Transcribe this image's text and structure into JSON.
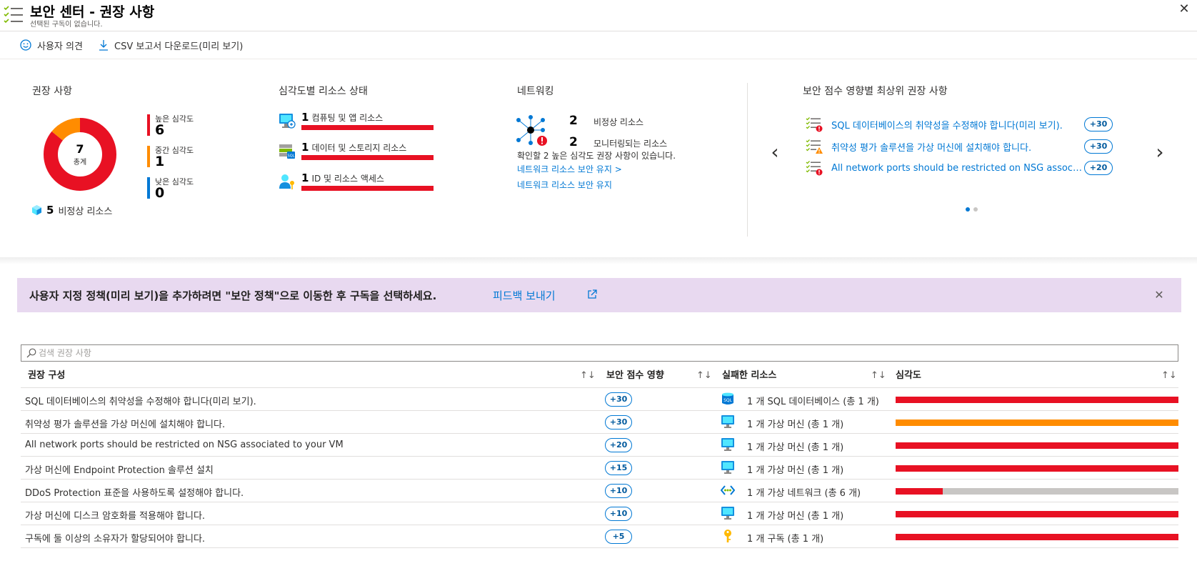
{
  "header": {
    "title": "보안 센터 - 권장 사항",
    "subtitle": "선택된 구독이 없습니다."
  },
  "toolbar": {
    "feedback_label": "사용자 의견",
    "download_label": "CSV 보고서 다운로드(미리 보기)"
  },
  "recommendations_summary": {
    "title": "권장 사항",
    "total": "7",
    "total_label": "총계",
    "high_label": "높은 심각도",
    "high_count": "6",
    "medium_label": "중간 심각도",
    "medium_count": "1",
    "low_label": "낮은 심각도",
    "low_count": "0",
    "unhealthy_count": "5",
    "unhealthy_label": "비정상 리소스",
    "colors": {
      "high": "#e81123",
      "medium": "#ff8c00",
      "low": "#0078d4"
    }
  },
  "resource_health": {
    "title": "심각도별 리소스 상태",
    "items": [
      {
        "count": "1",
        "label": "컴퓨팅 및 앱 리소스",
        "icon": "compute-icon"
      },
      {
        "count": "1",
        "label": "데이터 및 스토리지 리소스",
        "icon": "data-storage-icon"
      },
      {
        "count": "1",
        "label": "ID 및 리소스 액세스",
        "icon": "identity-icon"
      }
    ]
  },
  "networking": {
    "title": "네트워킹",
    "unhealthy_count": "2",
    "unhealthy_label": "비정상 리소스",
    "monitored_count": "2",
    "monitored_label": "모니터링되는 리소스",
    "note": "확인할 2 높은 심각도 권장 사항이 있습니다.",
    "link1": "네트워크 리소스 보안 유지 >",
    "link2": "네트워크 리소스 보안 유지"
  },
  "top_recommendations": {
    "title": "보안 점수 영향별 최상위 권장 사항",
    "items": [
      {
        "text": "SQL 데이터베이스의 취약성을 수정해야 합니다(미리 보기).",
        "score": "+30"
      },
      {
        "text": "취약성 평가 솔루션을 가상 머신에 설치해야 합니다.",
        "score": "+30"
      },
      {
        "text": "All network ports should be restricted on NSG associate...",
        "score": "+20"
      }
    ]
  },
  "banner": {
    "text": "사용자 지정 정책(미리 보기)을 추가하려면 \"보안 정책\"으로 이동한 후 구독을 선택하세요.",
    "link": "피드백 보내기"
  },
  "search": {
    "placeholder": "검색 권장 사항",
    "value": ""
  },
  "table": {
    "headers": {
      "recommendation": "권장 구성",
      "score": "보안 점수 영향",
      "resources": "실패한 리소스",
      "severity": "심각도"
    },
    "sort_glyph": "↑↓",
    "rows": [
      {
        "name": "SQL 데이터베이스의 취약성을 수정해야 합니다(미리 보기).",
        "score": "+30",
        "resource_icon": "sql-database-icon",
        "resources": "1 개 SQL 데이터베이스 (총 1 개)",
        "severity": "high",
        "fill": 1.0
      },
      {
        "name": "취약성 평가 솔루션을 가상 머신에 설치해야 합니다.",
        "score": "+30",
        "resource_icon": "virtual-machine-icon",
        "resources": "1 개 가상 머신 (총 1 개)",
        "severity": "medium",
        "fill": 1.0
      },
      {
        "name": "All network ports should be restricted on NSG associated to your VM",
        "score": "+20",
        "resource_icon": "virtual-machine-icon",
        "resources": "1 개 가상 머신 (총 1 개)",
        "severity": "high",
        "fill": 1.0
      },
      {
        "name": "가상 머신에 Endpoint Protection 솔루션 설치",
        "score": "+15",
        "resource_icon": "virtual-machine-icon",
        "resources": "1 개 가상 머신 (총 1 개)",
        "severity": "high",
        "fill": 1.0
      },
      {
        "name": "DDoS Protection 표준을 사용하도록 설정해야 합니다.",
        "score": "+10",
        "resource_icon": "virtual-network-icon",
        "resources": "1 개 가상 네트워크 (총 6 개)",
        "severity": "high",
        "fill": 0.167
      },
      {
        "name": "가상 머신에 디스크 암호화를 적용해야 합니다.",
        "score": "+10",
        "resource_icon": "virtual-machine-icon",
        "resources": "1 개 가상 머신 (총 1 개)",
        "severity": "high",
        "fill": 1.0
      },
      {
        "name": "구독에 둘 이상의 소유자가 할당되어야 합니다.",
        "score": "+5",
        "resource_icon": "key-icon",
        "resources": "1 개 구독 (총 1 개)",
        "severity": "high",
        "fill": 1.0
      }
    ]
  }
}
